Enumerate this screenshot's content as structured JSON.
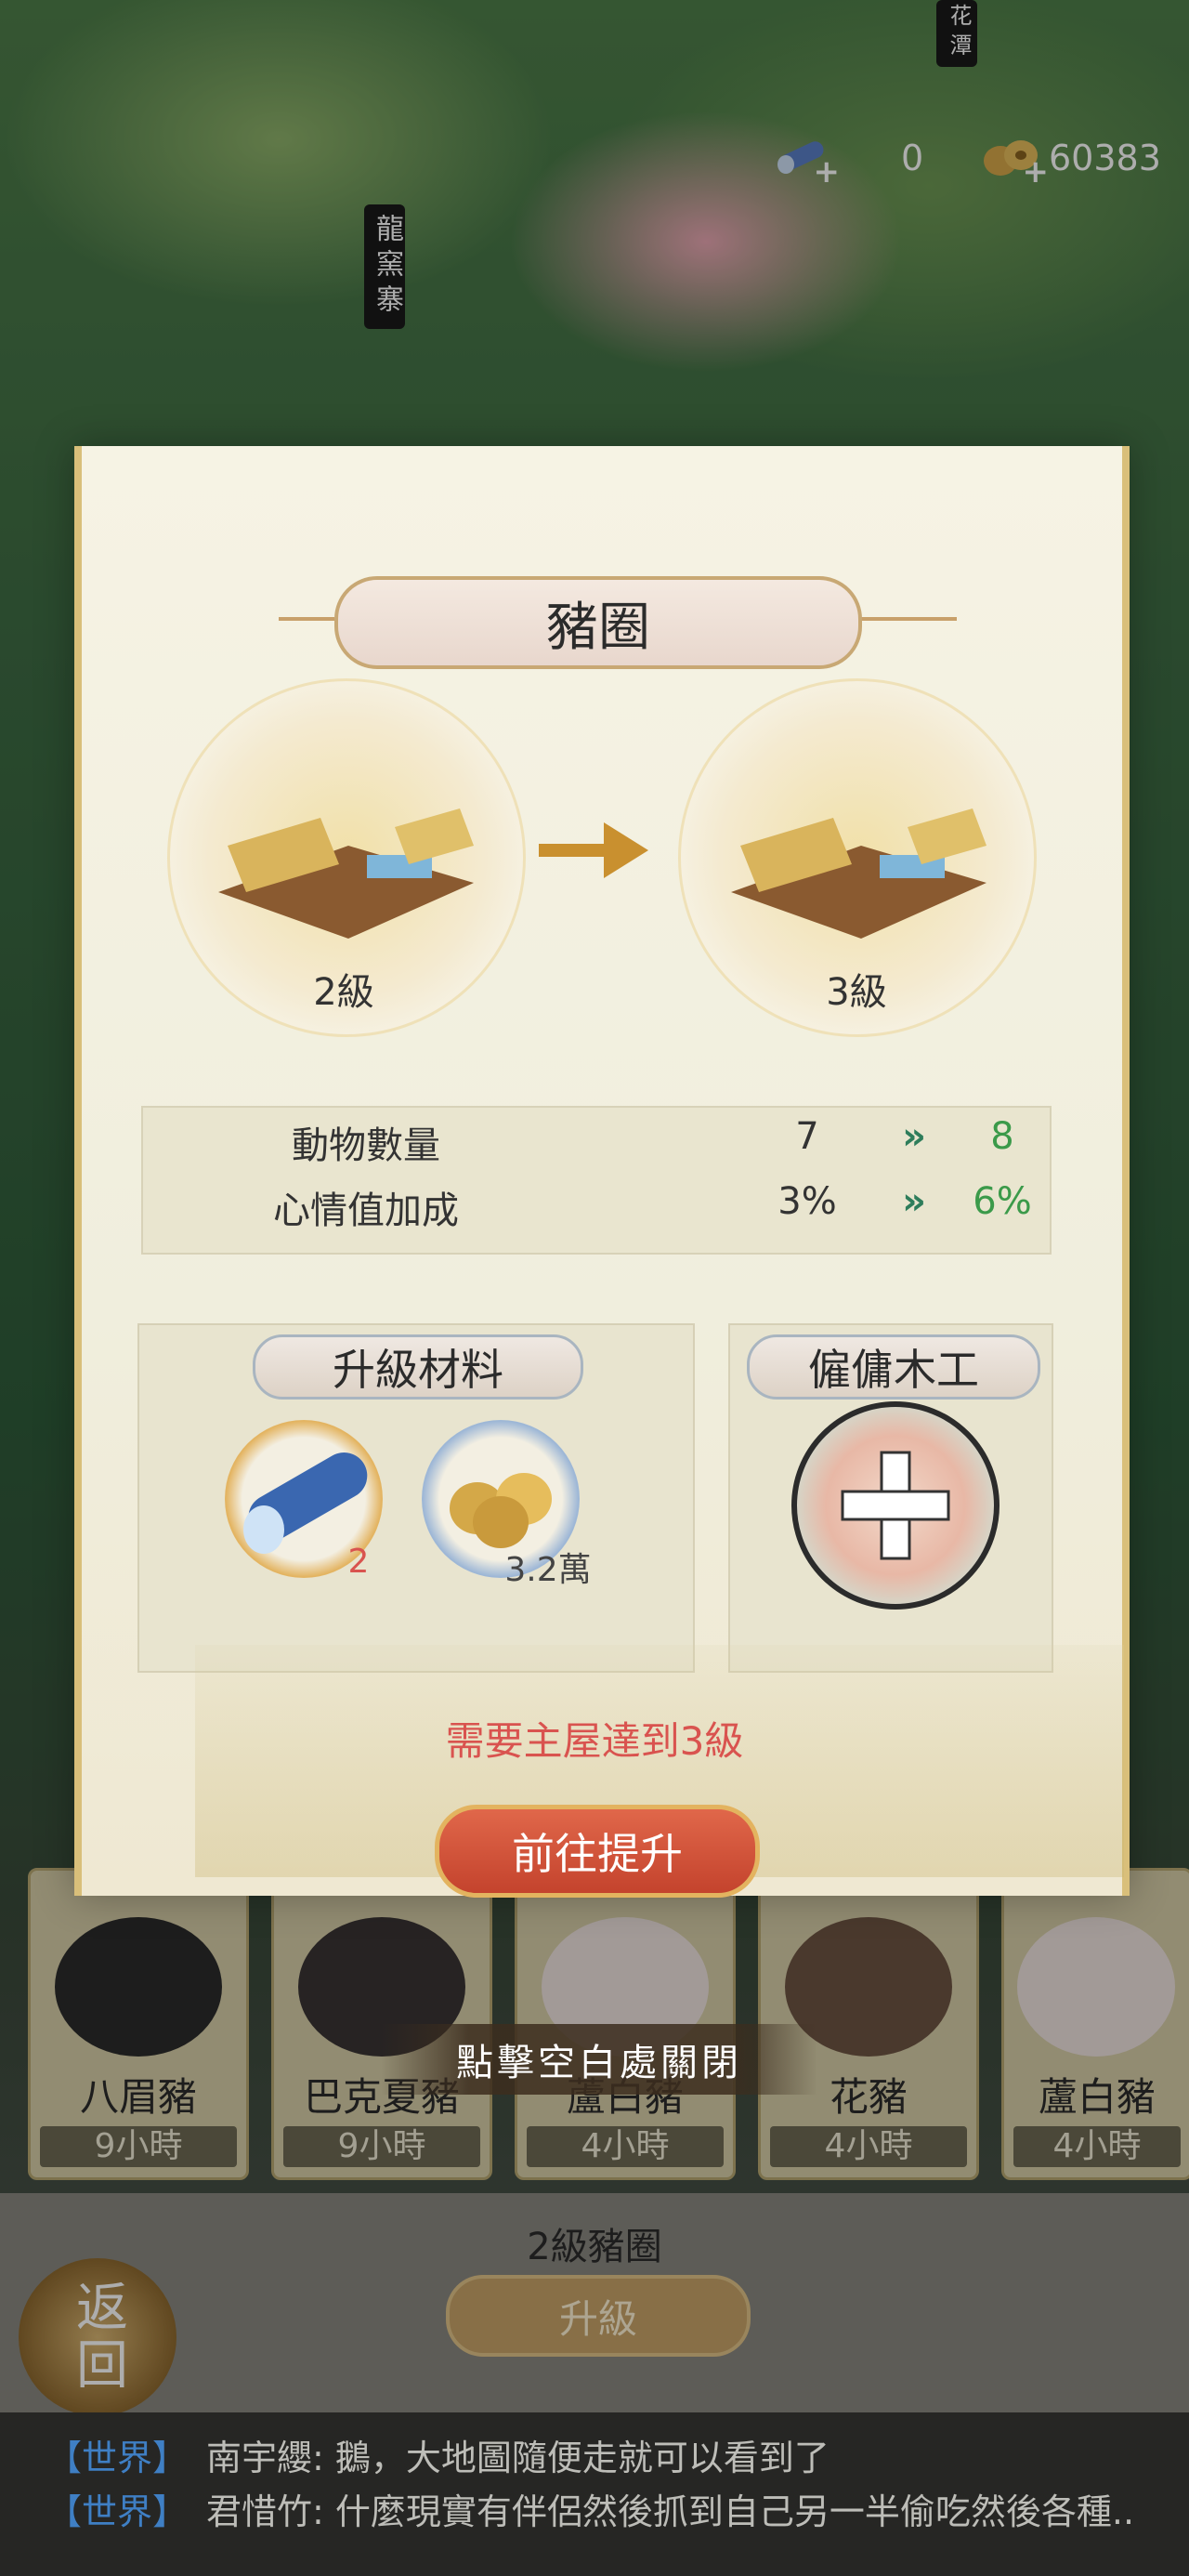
{
  "map": {
    "sign_left": "龍窯寨",
    "sign_top_right": "花潭"
  },
  "resources": {
    "scroll_count": "0",
    "coin_count": "60383",
    "scroll_icon": "scroll-icon",
    "coin_icon": "coins-icon"
  },
  "dialog": {
    "title": "豬圈",
    "current_level": "2級",
    "next_level": "3級",
    "stats": [
      {
        "label": "動物數量",
        "current": "7",
        "next": "8"
      },
      {
        "label": "心情值加成",
        "current": "3%",
        "next": "6%"
      }
    ],
    "materials_title": "升級材料",
    "materials": [
      {
        "icon": "wood-log-icon",
        "quantity": "2"
      },
      {
        "icon": "copper-coins-icon",
        "quantity": "3.2萬"
      }
    ],
    "hire_title": "僱傭木工",
    "requirement": "需要主屋達到3級",
    "go_button": "前往提升"
  },
  "close_hint": "點擊空白處關閉",
  "pigs": [
    {
      "name": "八眉豬",
      "time": "9小時",
      "color": "#2b2b2b"
    },
    {
      "name": "巴克夏豬",
      "time": "9小時",
      "color": "#3a3434"
    },
    {
      "name": "蘆白豬",
      "time": "4小時",
      "color": "#efe3df"
    },
    {
      "name": "花豬",
      "time": "4小時",
      "color": "#6e5443"
    },
    {
      "name": "蘆白豬",
      "time": "4小時",
      "color": "#efe3df"
    }
  ],
  "pen_label": "2級豬圈",
  "upgrade_button": "升級",
  "back_button": "返回",
  "chat": [
    {
      "channel": "【世界】",
      "message": "南宇纓: 鵝，大地圖隨便走就可以看到了"
    },
    {
      "channel": "【世界】",
      "message": "君惜竹: 什麼現實有伴侶然後抓到自己另一半偷吃然後各種.."
    }
  ],
  "colors": {
    "accent_red": "#d9534f",
    "increase_green": "#3b9a4a",
    "chat_channel": "#3f7fc4"
  }
}
